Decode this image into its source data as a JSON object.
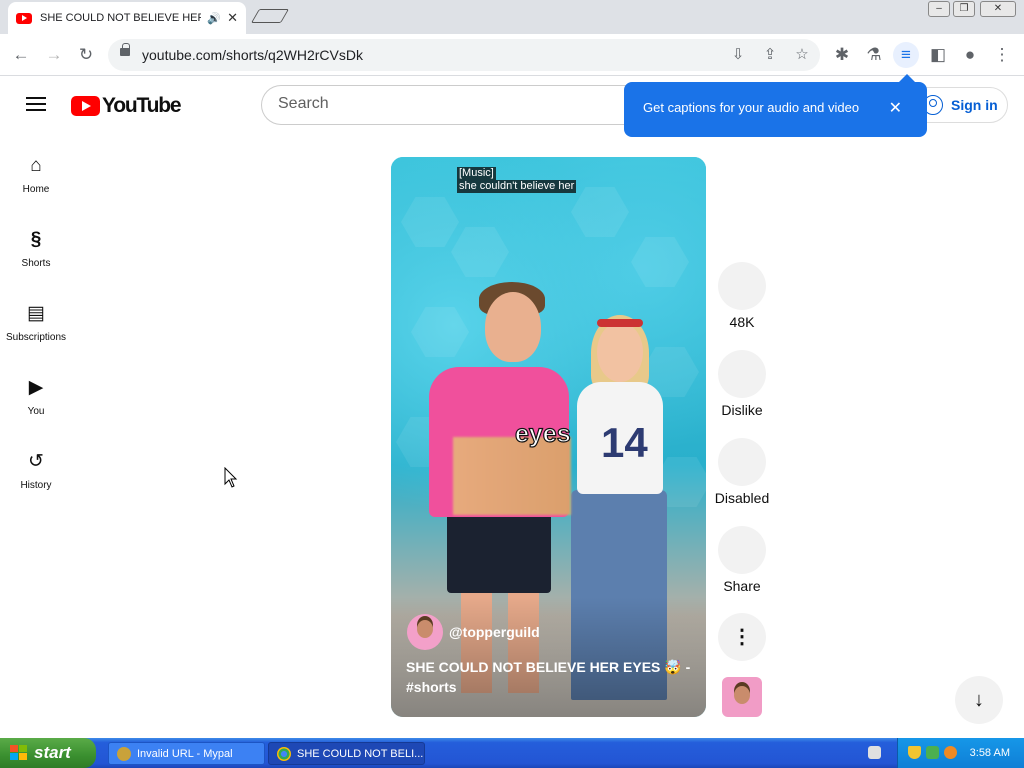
{
  "browser": {
    "tab_title": "SHE COULD NOT BELIEVE HER",
    "url": "youtube.com/shorts/q2WH2rCVsDk"
  },
  "youtube": {
    "logo_text": "YouTube",
    "search_placeholder": "Search",
    "signin_label": "Sign in",
    "caption_popup": "Get captions for your audio and video"
  },
  "sidebar": {
    "items": [
      {
        "label": "Home",
        "icon": "home-icon"
      },
      {
        "label": "Shorts",
        "icon": "shorts-icon"
      },
      {
        "label": "Subscriptions",
        "icon": "subscriptions-icon"
      },
      {
        "label": "You",
        "icon": "you-icon"
      },
      {
        "label": "History",
        "icon": "history-icon"
      }
    ]
  },
  "video": {
    "cc_line1": "[Music]",
    "cc_line2": "she couldn't believe her",
    "overlay_word": "eyes",
    "jersey_number": "14",
    "channel": "@topperguild",
    "title": "SHE COULD NOT BELIEVE HER EYES 🤯 - #shorts"
  },
  "actions": {
    "like_count": "48K",
    "dislike_label": "Dislike",
    "comments_label": "Disabled",
    "share_label": "Share"
  },
  "taskbar": {
    "start_label": "start",
    "task1": "Invalid URL - Mypal",
    "task2": "SHE COULD NOT BELI...",
    "clock": "3:58 AM"
  },
  "colors": {
    "yt_red": "#ff0000",
    "signin_blue": "#065fd4",
    "popup_blue": "#1a73e8"
  }
}
